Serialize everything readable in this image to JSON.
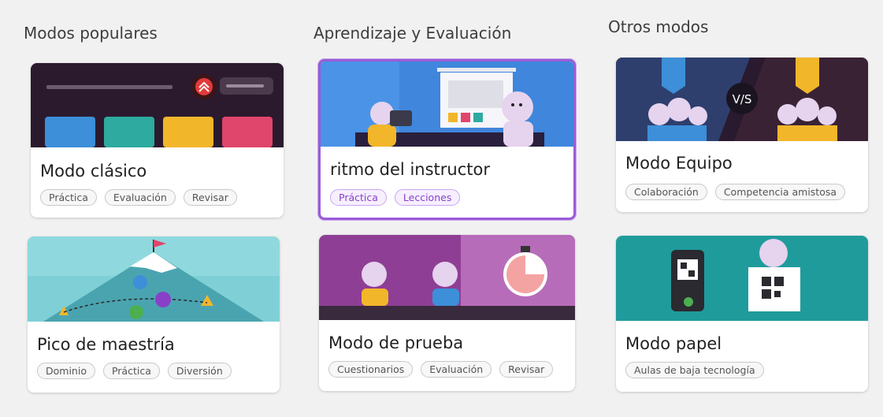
{
  "columns": {
    "popular": "Modos populares",
    "learning": "Aprendizaje y Evaluación",
    "other": "Otros modos"
  },
  "cards": {
    "classic": {
      "title": "Modo clásico",
      "tags": [
        "Práctica",
        "Evaluación",
        "Revisar"
      ]
    },
    "instructor": {
      "title": "ritmo del instructor",
      "tags": [
        "Práctica",
        "Lecciones"
      ],
      "selected": true
    },
    "team": {
      "title": "Modo Equipo",
      "tags": [
        "Colaboración",
        "Competencia amistosa"
      ],
      "vs_label": "V/S"
    },
    "mastery": {
      "title": "Pico de maestría",
      "tags": [
        "Dominio",
        "Práctica",
        "Diversión"
      ]
    },
    "test": {
      "title": "Modo de prueba",
      "tags": [
        "Cuestionarios",
        "Evaluación",
        "Revisar"
      ]
    },
    "paper": {
      "title": "Modo papel",
      "tags": [
        "Aulas de baja tecnología"
      ]
    }
  },
  "colors": {
    "selected_border": "#9a5cd6",
    "tag_purple": "#8a3fc9"
  }
}
